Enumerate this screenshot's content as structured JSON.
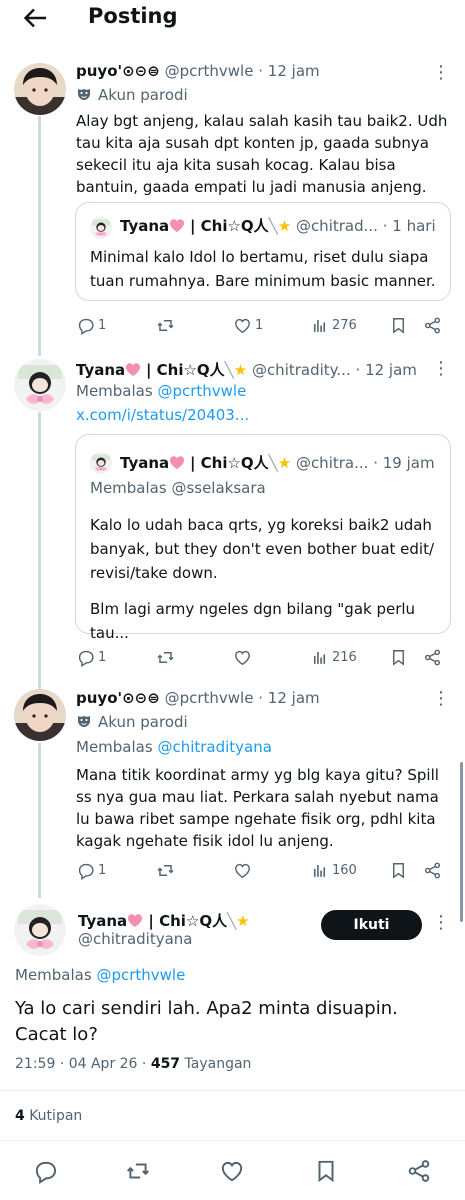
{
  "header": {
    "title": "Posting"
  },
  "posts": [
    {
      "name": "puyo'⊙⊝⊜",
      "handle": "@pcrthvwle",
      "time": "12 jam",
      "label": "Akun parodi",
      "text": "Alay bgt anjeng, kalau salah kasih tau baik2. Udh tau kita aja susah dpt konten jp, gaada subnya sekecil itu aja kita susah kocag. Kalau bisa bantuin, gaada empati lu jadi manusia anjeng.",
      "quote": {
        "name": "Tyana",
        "name_suffix": "| Chi☆Q人",
        "handle": "@chitrad...",
        "time": "1 hari",
        "text": "Minimal kalo Idol lo bertamu, riset dulu siapa tuan rumahnya. Bare minimum basic manner."
      },
      "actions": {
        "replies": "1",
        "reposts": "",
        "likes": "1",
        "views": "276"
      }
    },
    {
      "name": "Tyana",
      "name_suffix": "| Chi☆Q人",
      "handle": "@chitradity...",
      "time": "12 jam",
      "reply_prefix": "Membalas",
      "reply_to": "@pcrthvwle",
      "link": "x.com/i/status/20403...",
      "quote": {
        "name": "Tyana",
        "name_suffix": "| Chi☆Q人",
        "handle": "@chitra...",
        "time": "19 jam",
        "reply_prefix": "Membalas",
        "reply_to": "@sselaksara",
        "text1": "Kalo lo udah baca qrts, yg koreksi baik2 udah banyak, but they don't even bother buat edit/ revisi/take down.",
        "text2": "Blm lagi army ngeles dgn bilang \"gak perlu tau..."
      },
      "actions": {
        "replies": "1",
        "reposts": "",
        "likes": "",
        "views": "216"
      }
    },
    {
      "name": "puyo'⊙⊝⊜",
      "handle": "@pcrthvwle",
      "time": "12 jam",
      "label": "Akun parodi",
      "reply_prefix": "Membalas",
      "reply_to": "@chitradityana",
      "text": "Mana titik koordinat army yg blg kaya gitu? Spill ss nya gua mau liat. Perkara salah nyebut nama lu bawa ribet sampe ngehate fisik org, pdhl kita kagak ngehate fisik idol lu anjeng.",
      "actions": {
        "replies": "1",
        "reposts": "",
        "likes": "",
        "views": "160"
      }
    }
  ],
  "main": {
    "name": "Tyana",
    "name_suffix": "| Chi☆Q人",
    "handle": "@chitradityana",
    "follow_label": "Ikuti",
    "reply_prefix": "Membalas",
    "reply_to": "@pcrthvwle",
    "text": "Ya lo cari sendiri lah. Apa2 minta disuapin. Cacat lo?",
    "time": "21:59",
    "date": "04 Apr 26",
    "views": "457",
    "views_label": "Tayangan",
    "quotes_count": "4",
    "quotes_label": "Kutipan"
  },
  "icons": [
    "back-arrow-icon",
    "more-icon",
    "parody-mask-icon",
    "reply-icon",
    "repost-icon",
    "like-icon",
    "views-icon",
    "bookmark-icon",
    "share-icon",
    "pink-heart-emoji",
    "star-emoji",
    "spoon-emoji"
  ]
}
